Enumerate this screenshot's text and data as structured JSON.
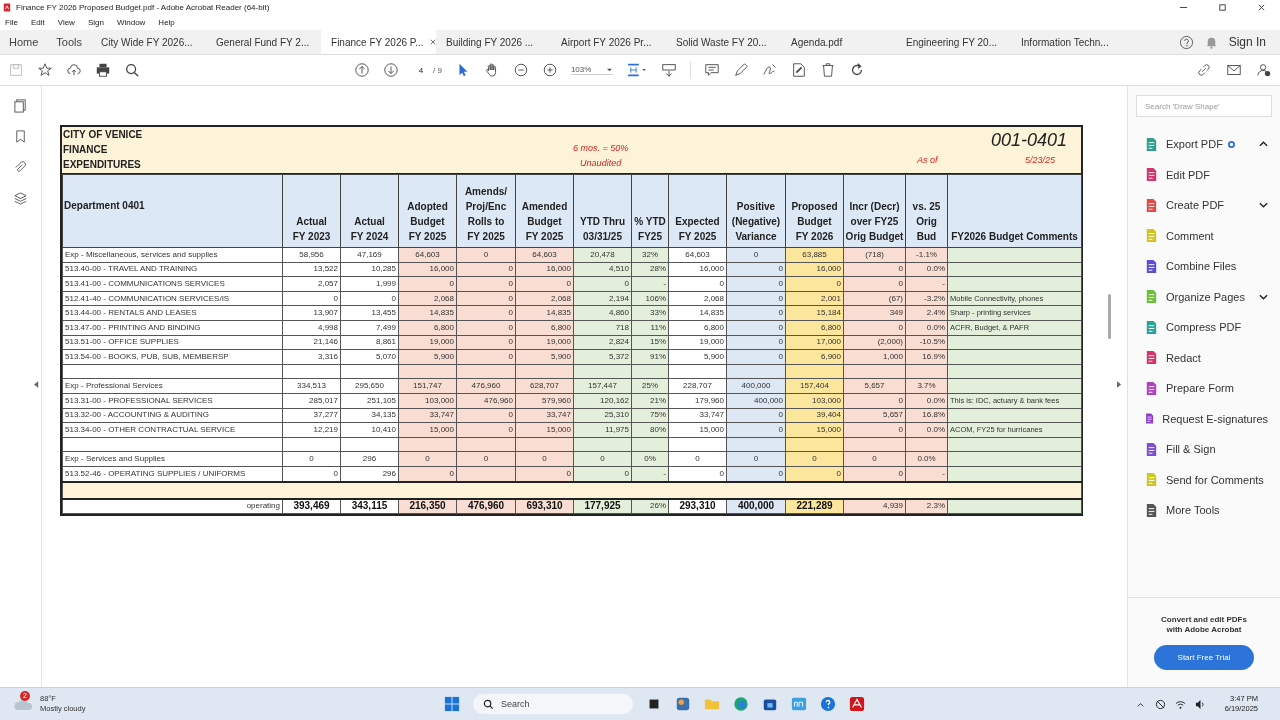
{
  "window": {
    "title": "Finance FY 2026 Proposed Budget.pdf - Adobe Acrobat Reader (64-bit)"
  },
  "menu": [
    "File",
    "Edit",
    "View",
    "Sign",
    "Window",
    "Help"
  ],
  "nav": [
    "Home",
    "Tools"
  ],
  "tabs": [
    {
      "label": "City Wide FY 2026...",
      "selected": false
    },
    {
      "label": "General Fund FY 2...",
      "selected": false
    },
    {
      "label": "Finance FY 2026 P...",
      "selected": true
    },
    {
      "label": "Building FY 2026 ...",
      "selected": false
    },
    {
      "label": "Airport FY 2026 Pr...",
      "selected": false
    },
    {
      "label": "Solid Waste FY 20...",
      "selected": false
    },
    {
      "label": "Agenda.pdf",
      "selected": false
    },
    {
      "label": "Engineering FY 20...",
      "selected": false
    },
    {
      "label": "Information Techn...",
      "selected": false
    }
  ],
  "sign_in": "Sign In",
  "toolbar": {
    "page": "4",
    "page_count": "/ 9",
    "zoom": "103%"
  },
  "sheet": {
    "org": [
      "CITY OF VENICE",
      "FINANCE",
      "EXPENDITURES"
    ],
    "note": [
      "6 mos. = 50%",
      "Unaudited"
    ],
    "code": "001-0401",
    "as_of": "As of",
    "date": "5/23/25",
    "columns": [
      "Department 0401",
      "Actual\nFY 2023",
      "Actual\nFY 2024",
      "Adopted\nBudget\nFY 2025",
      "Amends/\nProj/Enc\nRolls to\nFY 2025",
      "Amended\nBudget\nFY 2025",
      "YTD Thru\n03/31/25",
      "% YTD\nFY25",
      "Expected\nFY 2025",
      "Positive\n(Negative)\nVariance",
      "Proposed\nBudget\nFY 2026",
      "Incr (Decr)\nover FY25\nOrig Budget",
      "vs. 25\nOrig\nBud",
      "FY2026 Budget Comments"
    ],
    "rows": [
      {
        "kind": "group",
        "label": "Exp - Miscellaneous, services and supplies",
        "cells": [
          "58,956",
          "47,169",
          "64,603",
          "0",
          "64,603",
          "20,478",
          "32%",
          "64,603",
          "0",
          "63,885",
          "(718)",
          "-1.1%",
          null
        ]
      },
      {
        "kind": "line",
        "label": "513.40-00 - TRAVEL AND TRAINING",
        "cells": [
          "13,522",
          "10,285",
          "16,000",
          "0",
          "16,000",
          "4,510",
          "28%",
          "16,000",
          "0",
          "16,000",
          "0",
          "0.0%",
          null
        ]
      },
      {
        "kind": "line",
        "label": "513.41-00 - COMMUNICATIONS SERVICES",
        "cells": [
          "2,057",
          "1,999",
          "0",
          "0",
          "0",
          "0",
          "-",
          "0",
          "0",
          "0",
          "0",
          "-",
          null
        ]
      },
      {
        "kind": "line",
        "label": "512.41-40 - COMMUNICATION SERVICES/IS",
        "cells": [
          "0",
          "0",
          "2,068",
          "0",
          "2,068",
          "2,194",
          "106%",
          "2,068",
          "0",
          "2,001",
          "(67)",
          "-3.2%",
          "Mobile Connectivity, phones"
        ]
      },
      {
        "kind": "line",
        "label": "513.44-00 - RENTALS AND LEASES",
        "cells": [
          "13,907",
          "13,455",
          "14,835",
          "0",
          "14,835",
          "4,860",
          "33%",
          "14,835",
          "0",
          "15,184",
          "349",
          "2.4%",
          "Sharp - printing services"
        ]
      },
      {
        "kind": "line",
        "label": "513.47-00 - PRINTING AND BINDING",
        "cells": [
          "4,998",
          "7,499",
          "6,800",
          "0",
          "6,800",
          "718",
          "11%",
          "6,800",
          "0",
          "6,800",
          "0",
          "0.0%",
          "ACFR, Budget, & PAFR"
        ]
      },
      {
        "kind": "line",
        "label": "513.51-00 - OFFICE SUPPLIES",
        "cells": [
          "21,146",
          "8,861",
          "19,000",
          "0",
          "19,000",
          "2,824",
          "15%",
          "19,000",
          "0",
          "17,000",
          "(2,000)",
          "-10.5%",
          null
        ]
      },
      {
        "kind": "line",
        "label": "513.54-00 - BOOKS, PUB, SUB, MEMBERSP",
        "cells": [
          "3,316",
          "5,070",
          "5,900",
          "0",
          "5,900",
          "5,372",
          "91%",
          "5,900",
          "0",
          "6,900",
          "1,000",
          "16.9%",
          null
        ]
      },
      {
        "kind": "blank"
      },
      {
        "kind": "group",
        "label": "Exp - Professional Services",
        "cells": [
          "334,513",
          "295,650",
          "151,747",
          "476,960",
          "628,707",
          "157,447",
          "25%",
          "228,707",
          "400,000",
          "157,404",
          "5,657",
          "3.7%",
          null
        ]
      },
      {
        "kind": "line",
        "label": "513.31-00 - PROFESSIONAL SERVICES",
        "cells": [
          "285,017",
          "251,105",
          "103,000",
          "476,960",
          "579,960",
          "120,162",
          "21%",
          "179,960",
          "400,000",
          "103,000",
          "0",
          "0.0%",
          "This is: IDC, actuary & bank fees"
        ]
      },
      {
        "kind": "line",
        "label": "513.32-00 - ACCOUNTING & AUDITING",
        "cells": [
          "37,277",
          "34,135",
          "33,747",
          "0",
          "33,747",
          "25,310",
          "75%",
          "33,747",
          "0",
          "39,404",
          "5,657",
          "16.8%",
          null
        ]
      },
      {
        "kind": "line",
        "label": "513.34-00 - OTHER CONTRACTUAL SERVICE",
        "cells": [
          "12,219",
          "10,410",
          "15,000",
          "0",
          "15,000",
          "11,975",
          "80%",
          "15,000",
          "0",
          "15,000",
          "0",
          "0.0%",
          "ACOM, FY25 for hurricanes"
        ]
      },
      {
        "kind": "blank"
      },
      {
        "kind": "group",
        "label": "Exp - Services and Supplies",
        "cells": [
          "0",
          "296",
          "0",
          "0",
          "0",
          "0",
          "0%",
          "0",
          "0",
          "0",
          "0",
          "0.0%",
          null
        ]
      },
      {
        "kind": "line",
        "label": "513.52-46 - OPERATING SUPPLIES / UNIFORMS",
        "cells": [
          "0",
          "296",
          "0",
          null,
          "0",
          "0",
          "-",
          "0",
          "0",
          "0",
          "0",
          "-",
          null
        ]
      },
      {
        "kind": "spacer"
      },
      {
        "kind": "total",
        "label": "operating",
        "cells": [
          "393,469",
          "343,115",
          "216,350",
          "476,960",
          "693,310",
          "177,925",
          "26%",
          "293,310",
          "400,000",
          "221,289",
          "4,939",
          "2.3%",
          null
        ]
      }
    ]
  },
  "tools_panel": {
    "search": {
      "placeholder": "Search 'Draw Shape'"
    },
    "items": [
      {
        "label": "Export PDF",
        "color": "#2e9f8c",
        "expanded": true,
        "new_dot": true
      },
      {
        "label": "Edit PDF",
        "color": "#d6336c"
      },
      {
        "label": "Create PDF",
        "color": "#e04a4a",
        "expanded": false
      },
      {
        "label": "Comment",
        "color": "#d2c320"
      },
      {
        "label": "Combine Files",
        "color": "#5b4fd6"
      },
      {
        "label": "Organize Pages",
        "color": "#6cbf3a",
        "expanded": false
      },
      {
        "label": "Compress PDF",
        "color": "#2aa198"
      },
      {
        "label": "Redact",
        "color": "#d6336c"
      },
      {
        "label": "Prepare Form",
        "color": "#b040c0"
      },
      {
        "label": "Request E-signatures",
        "color": "#8a3fc8"
      },
      {
        "label": "Fill & Sign",
        "color": "#7a4fd0"
      },
      {
        "label": "Send for Comments",
        "color": "#c8c820"
      },
      {
        "label": "More Tools",
        "color": "#555555"
      }
    ],
    "promo": "Convert and edit PDFs\nwith Adobe Acrobat",
    "trial_button": "Start Free Trial"
  },
  "taskbar": {
    "notifications": "2",
    "temperature": "88°F",
    "weather": "Mostly cloudy",
    "search": {
      "placeholder": "Search"
    },
    "time": "3:47 PM",
    "date": "6/19/2025"
  }
}
